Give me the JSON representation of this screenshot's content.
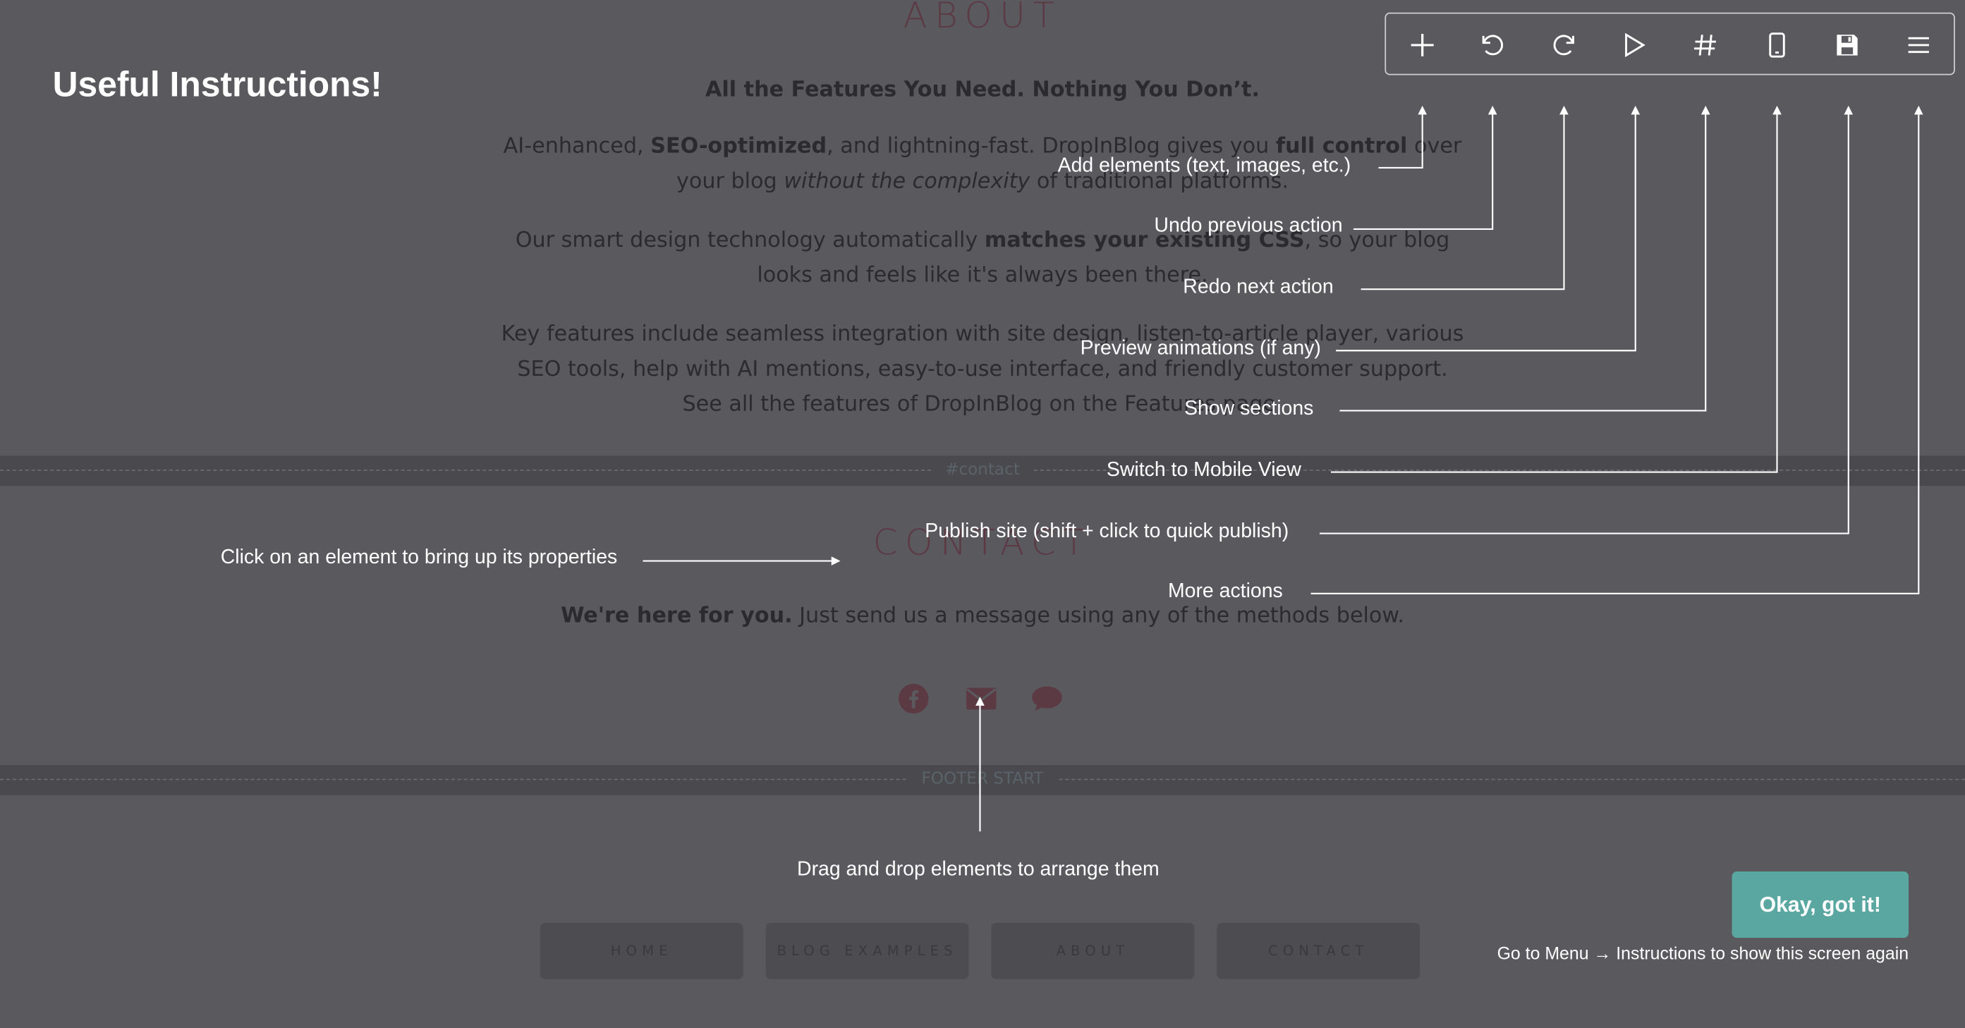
{
  "about": {
    "title": "ABOUT",
    "tagline": "All the Features You Need. Nothing You Don’t.",
    "p1": {
      "a": "AI-enhanced, ",
      "b": "SEO-optimized",
      "c": ", and lightning-fast. DropInBlog gives you ",
      "d": "full control",
      "e": " over your blog ",
      "f": "without the complexity",
      "g": " of traditional platforms."
    },
    "p2": {
      "a": "Our smart design technology automatically ",
      "b": "matches your existing CSS",
      "c": ", so your blog looks and feels like it's always been there."
    },
    "p3": "Key features include seamless integration with site design, listen-to-article player, various SEO tools, help with AI mentions, easy-to-use interface, and friendly customer support. See all the features of DropInBlog on the Features page."
  },
  "dividers": {
    "contact": "#contact",
    "footer": "FOOTER START"
  },
  "contact": {
    "title": "CONTACT",
    "strong": "We're here for you.",
    "rest": " Just send us a message using any of the methods below.",
    "icons": [
      "facebook-icon",
      "mail-icon",
      "chat-icon"
    ]
  },
  "nav": [
    "HOME",
    "BLOG EXAMPLES",
    "ABOUT",
    "CONTACT"
  ],
  "overlay": {
    "heading": "Useful Instructions!",
    "toolbar_icons": [
      "plus-icon",
      "undo-icon",
      "redo-icon",
      "play-icon",
      "hash-icon",
      "mobile-icon",
      "save-icon",
      "menu-icon"
    ],
    "annotations": {
      "add": "Add elements (text, images, etc.)",
      "undo": "Undo previous action",
      "redo": "Redo next action",
      "preview": "Preview animations (if any)",
      "sections": "Show sections",
      "mobile": "Switch to Mobile View",
      "publish": "Publish site (shift + click to quick publish)",
      "more": "More actions",
      "click": "Click on an element to bring up its properties",
      "drag": "Drag and drop elements to arrange them"
    },
    "ok_button": "Okay, got it!",
    "menu_hint": "Go to Menu → Instructions to show this screen again"
  },
  "colors": {
    "overlay": "#5a595e",
    "accent": "#5aa7a1",
    "title": "#5c3a44"
  }
}
